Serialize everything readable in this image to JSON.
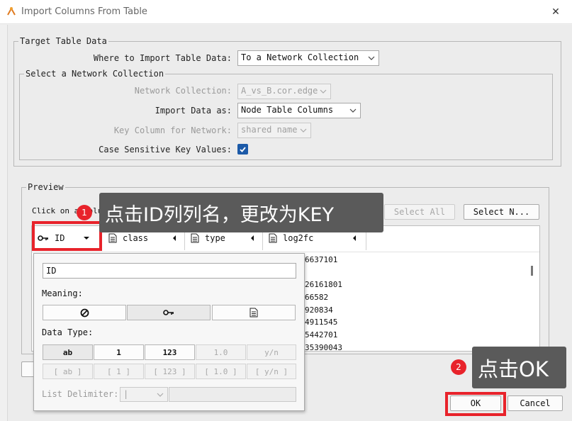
{
  "window": {
    "title": "Import Columns From Table",
    "close_glyph": "✕"
  },
  "target_section": {
    "legend": "Target Table Data",
    "where_label": "Where to Import Table Data:",
    "where_value": "To a Network Collection",
    "select_network_legend": "Select a Network Collection",
    "network_collection_label": "Network Collection:",
    "network_collection_value": "A_vs_B.cor.edge",
    "import_as_label": "Import Data as:",
    "import_as_value": "Node Table Columns",
    "key_column_label": "Key Column for Network:",
    "key_column_value": "shared name",
    "case_sensitive_label": "Case Sensitive Key Values:",
    "case_sensitive_checked": true
  },
  "preview": {
    "legend": "Preview",
    "hint": "Click on a column",
    "select_all": "Select All",
    "select_none": "Select N...",
    "columns": [
      {
        "name": "ID",
        "icon": "key-icon"
      },
      {
        "name": "class",
        "icon": "document-icon"
      },
      {
        "name": "type",
        "icon": "document-icon"
      },
      {
        "name": "log2fc",
        "icon": "document-icon"
      }
    ],
    "visible_values": [
      "6637101",
      "26161801",
      "66582",
      "920834",
      "4911545",
      "5442701",
      "35390043"
    ]
  },
  "column_popup": {
    "name_value": "ID",
    "meaning_label": "Meaning:",
    "meaning_options": [
      "none-icon",
      "key-icon",
      "document-icon"
    ],
    "data_type_label": "Data Type:",
    "data_types_row1": [
      "ab",
      "1",
      "123",
      "1.0",
      "y/n"
    ],
    "data_types_row2": [
      "[ ab ]",
      "[ 1 ]",
      "[ 123 ]",
      "[ 1.0 ]",
      "[ y/n ]"
    ],
    "list_delimiter_label": "List Delimiter:",
    "list_delimiter_value": "|"
  },
  "footer": {
    "ok": "OK",
    "cancel": "Cancel"
  },
  "annotations": {
    "step1_badge": "1",
    "step1_text": "点击ID列列名，更改为KEY",
    "step2_badge": "2",
    "step2_text": "点击OK"
  },
  "colors": {
    "accent_red": "#e8232b",
    "tooltip_bg": "#5a5a5a",
    "checkbox_blue": "#1c5aa8"
  }
}
